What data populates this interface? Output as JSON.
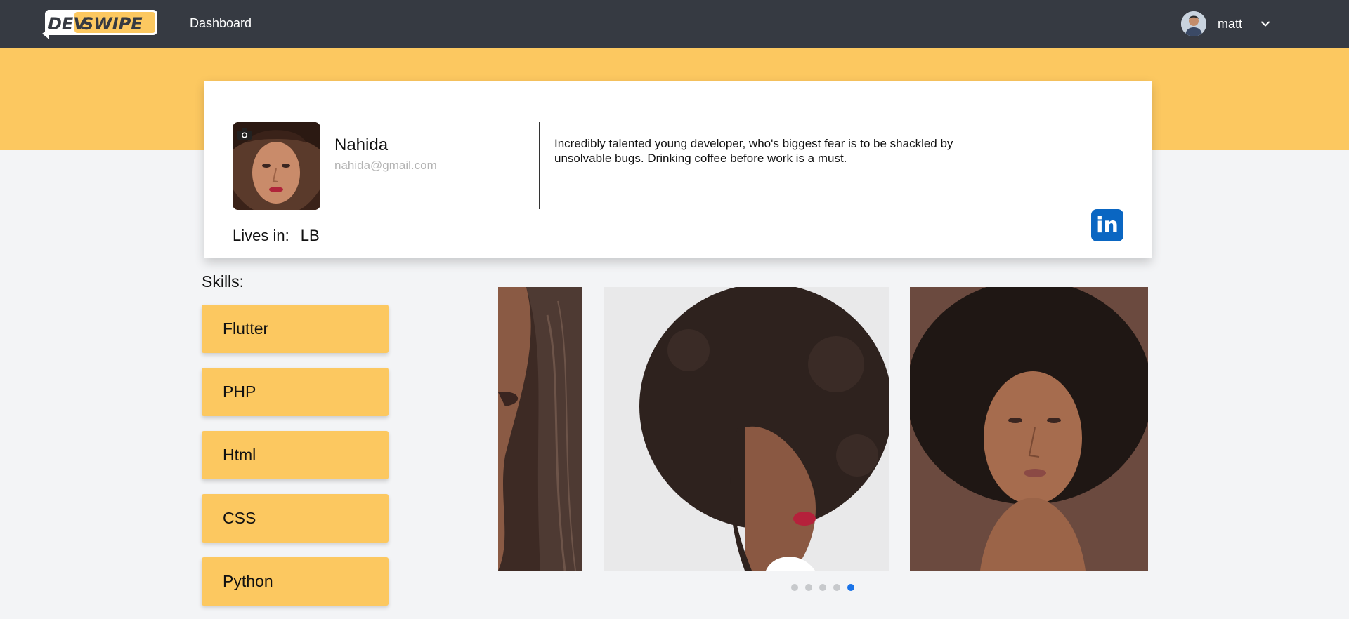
{
  "nav": {
    "logo_text": "DEVSWIPE",
    "dashboard_label": "Dashboard",
    "user_name": "matt"
  },
  "profile": {
    "name": "Nahida",
    "email": "nahida@gmail.com",
    "bio": "Incredibly talented young developer, who's biggest fear is to be shackled by unsolvable bugs. Drinking coffee before work is a must.",
    "lives_label": "Lives in:",
    "lives_value": "LB",
    "linkedin_label": "in"
  },
  "skills": {
    "title": "Skills:",
    "items": [
      "Flutter",
      "PHP",
      "Html",
      "CSS",
      "Python"
    ]
  },
  "carousel": {
    "slide_count": 5,
    "active_index": 4
  },
  "colors": {
    "nav_bg": "#363a42",
    "accent_yellow": "#fcc860",
    "linkedin_blue": "#0a66c2",
    "active_dot": "#1a73e8"
  }
}
